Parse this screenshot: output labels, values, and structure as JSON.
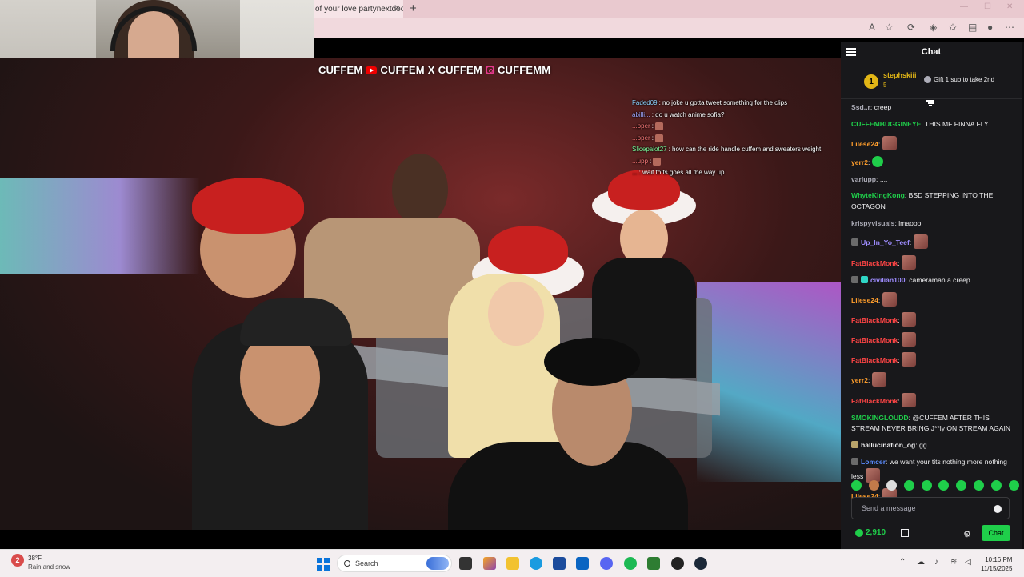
{
  "browser": {
    "tab_title": "of your love partynextdoor",
    "tab_close": "×",
    "new_tab": "+"
  },
  "video": {
    "brand": {
      "name1": "CUFFEM",
      "name2": "CUFFEM",
      "separator": "X",
      "name3": "CUFFEM",
      "name4": "CUFFEMM"
    },
    "overlay_chat": [
      {
        "user": "Faded09",
        "text": ": no joke u gotta tweet something for the clips",
        "color": "#8fd3ff"
      },
      {
        "user": "abilli...",
        "text": ": do u watch anime sofia?",
        "color": "#9fa8ff"
      },
      {
        "user": "...pper",
        "text": ":",
        "color": "#ff7b7b",
        "emote": true
      },
      {
        "user": "...pper",
        "text": ":",
        "color": "#ff7b7b",
        "emote": true
      },
      {
        "user": "Slicepalot27",
        "text": ": how can the ride handle cuffem and sweaters weight",
        "color": "#7dff9e"
      },
      {
        "user": "...upp",
        "text": ":",
        "color": "#ff7b7b",
        "emote": true
      },
      {
        "user": "...",
        "text": ": wait to ts goes all the way up",
        "color": "#8fb3ff"
      }
    ]
  },
  "chat": {
    "title": "Chat",
    "sub_banner": {
      "crown": "1",
      "name": "stephskiii",
      "count": "5",
      "gift_text": "Gift 1 sub to take 2nd"
    },
    "messages": [
      {
        "user": "Ssd..r",
        "text": ": creep",
        "color": "#adadb8"
      },
      {
        "user": "CUFFEMBUGGINEYE",
        "text": ": THIS MF FINNA FLY",
        "color": "#1fce4a"
      },
      {
        "user": "Lilese24",
        "text": ":",
        "color": "#ff9e2c",
        "emote": "face"
      },
      {
        "user": "yerr2",
        "text": ":",
        "color": "#ff9e2c",
        "emote": "green"
      },
      {
        "user": "varlupp",
        "text": ": ....",
        "color": "#adadb8"
      },
      {
        "user": "WhyteKingKong",
        "text": ": BSD STEPPING INTO THE OCTAGON",
        "color": "#1fce4a"
      },
      {
        "user": "krispyvisuals",
        "text": ": lmaooo",
        "color": "#adadb8"
      },
      {
        "user": "Up_In_Yo_Teef",
        "text": ":",
        "color": "#9e8cff",
        "emote": "face",
        "badge": "#6b6b6b"
      },
      {
        "user": "FatBlackMonk",
        "text": ":",
        "color": "#ff4545",
        "emote": "face"
      },
      {
        "user": "civilian100",
        "text": ": cameraman a creep",
        "color": "#9e8cff",
        "badge": "#6b6b6b",
        "badge2": "#2fd6c5"
      },
      {
        "user": "Lilese24",
        "text": ":",
        "color": "#ff9e2c",
        "emote": "face"
      },
      {
        "user": "FatBlackMonk",
        "text": ":",
        "color": "#ff4545",
        "emote": "face"
      },
      {
        "user": "FatBlackMonk",
        "text": ":",
        "color": "#ff4545",
        "emote": "face"
      },
      {
        "user": "FatBlackMonk",
        "text": ":",
        "color": "#ff4545",
        "emote": "face"
      },
      {
        "user": "yerr2",
        "text": ":",
        "color": "#ff9e2c",
        "emote": "face"
      },
      {
        "user": "FatBlackMonk",
        "text": ":",
        "color": "#ff4545",
        "emote": "face"
      },
      {
        "user": "SMOKINGLOUDD",
        "text": ": @CUFFEM AFTER THIS STREAM NEVER BRING J**ly ON STREAM AGAIN",
        "color": "#1fce4a"
      },
      {
        "user": "hallucination_og",
        "text": ": gg",
        "color": "#efeff1",
        "badge": "#b8a36a"
      },
      {
        "user": "Lomcer",
        "text": ": we want your tits nothing more nothing less",
        "color": "#5b8cff",
        "badge": "#6b6b6b",
        "emote": "face"
      },
      {
        "user": "Lilese24",
        "text": ":",
        "color": "#ff9e2c",
        "emote": "face"
      }
    ],
    "input_placeholder": "Send a message",
    "points": "2,910",
    "chat_button": "Chat"
  },
  "taskbar": {
    "weather_badge": "2",
    "temp": "38°F",
    "desc": "Rain and snow",
    "search": "Search",
    "time": "10:16 PM",
    "date": "11/15/2025"
  }
}
